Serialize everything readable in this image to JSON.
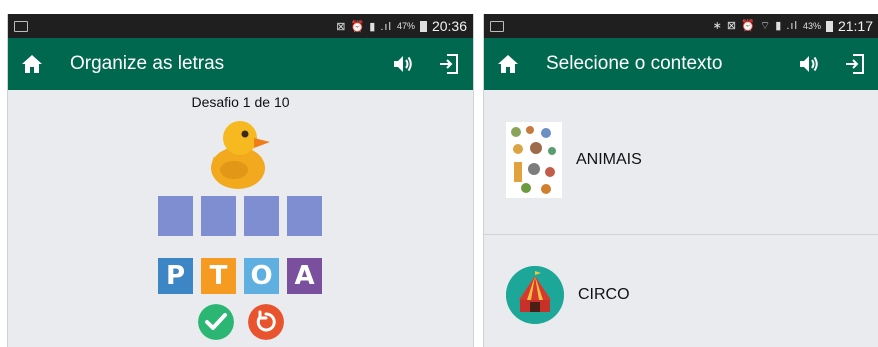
{
  "left_screen": {
    "status_bar": {
      "icons": "⊠ ⏰ ▮ .ıl",
      "battery": "47%",
      "time": "20:36"
    },
    "app_bar": {
      "title": "Organize as letras"
    },
    "challenge_label": "Desafio 1 de 10",
    "picture": "duck-icon",
    "answer_slots": 4,
    "letter_tiles": [
      {
        "letter": "P",
        "color": "#3d86c6"
      },
      {
        "letter": "T",
        "color": "#f59b22"
      },
      {
        "letter": "O",
        "color": "#5fb0e0"
      },
      {
        "letter": "A",
        "color": "#7a4f9e"
      }
    ],
    "buttons": {
      "confirm_icon": "check-icon",
      "reset_icon": "undo-icon"
    }
  },
  "right_screen": {
    "status_bar": {
      "icons": "∗ ⊠ ⏰ ⌔ ▮ .ıl",
      "battery": "43%",
      "time": "21:17"
    },
    "app_bar": {
      "title": "Selecione o contexto"
    },
    "contexts": [
      {
        "label": "ANIMAIS",
        "icon": "animals-thumbnail"
      },
      {
        "label": "CIRCO",
        "icon": "circus-tent-icon"
      }
    ]
  },
  "colors": {
    "app_bar": "#00684f",
    "status_bar": "#1f1f1f",
    "slot": "#7f8ed1",
    "confirm": "#2bb673",
    "reset": "#e8542e"
  }
}
